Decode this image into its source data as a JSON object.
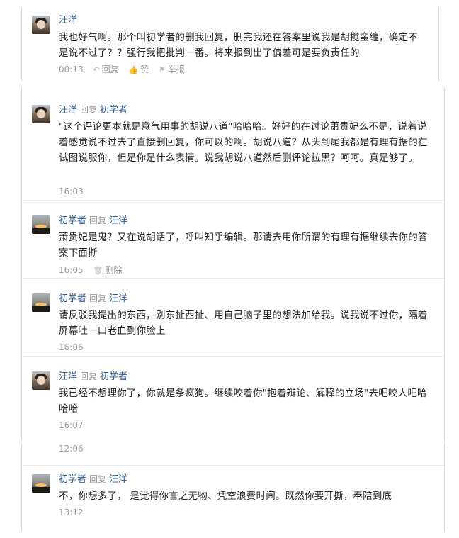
{
  "comments": [
    {
      "author": "汪洋",
      "reply_word": "",
      "reply_to": "",
      "body": "我也好气啊。那个叫初学者的删我回复，删完我还在答案里说我是胡搅蛮缠，确定不是说不过了？？强行我把批判一番。将来报到出了偏差可是要负责任的",
      "time": "00:13",
      "actions": {
        "reply": "回复",
        "like": "赞",
        "report": "举报"
      }
    },
    {
      "author": "汪洋",
      "reply_word": "回复",
      "reply_to": "初学者",
      "body": "\"这个评论更本就是意气用事的胡说八道\"哈哈哈。好好的在讨论萧贵妃么不是，说着说着感觉说不过去了直接删回复，你可以的啊。胡说八道？从头到尾我都是有理有据的在试图说服你，但是你是什么表情。说我胡说八道然后删评论拉黑？呵呵。真是够了。",
      "time": "16:03"
    },
    {
      "author": "初学者",
      "reply_word": "回复",
      "reply_to": "汪洋",
      "body": "萧贵妃是鬼？又在说胡话了，呼叫知乎编辑。那请去用你所谓的有理有据继续去你的答案下面撕",
      "time": "16:05",
      "delete_label": "删除"
    },
    {
      "author": "初学者",
      "reply_word": "回复",
      "reply_to": "汪洋",
      "body": "请反驳我提出的东西，别东扯西扯、用自己脑子里的想法加给我。说我说不过你，隔着屏幕吐一口老血到你脸上",
      "time": "16:06"
    },
    {
      "author": "汪洋",
      "reply_word": "回复",
      "reply_to": "初学者",
      "body": "我已经不想理你了，你就是条疯狗。继续咬着你\"抱着辩论、解释的立场\"去吧咬人吧哈哈哈",
      "time": "16:07"
    },
    {
      "author": "初学者",
      "reply_word": "回复",
      "reply_to": "汪洋",
      "body": "不，你想多了， 是觉得你言之无物、凭空浪费时间。既然你要开撕，奉陪到底",
      "time": "13:12"
    }
  ],
  "stray_time": "12:06"
}
